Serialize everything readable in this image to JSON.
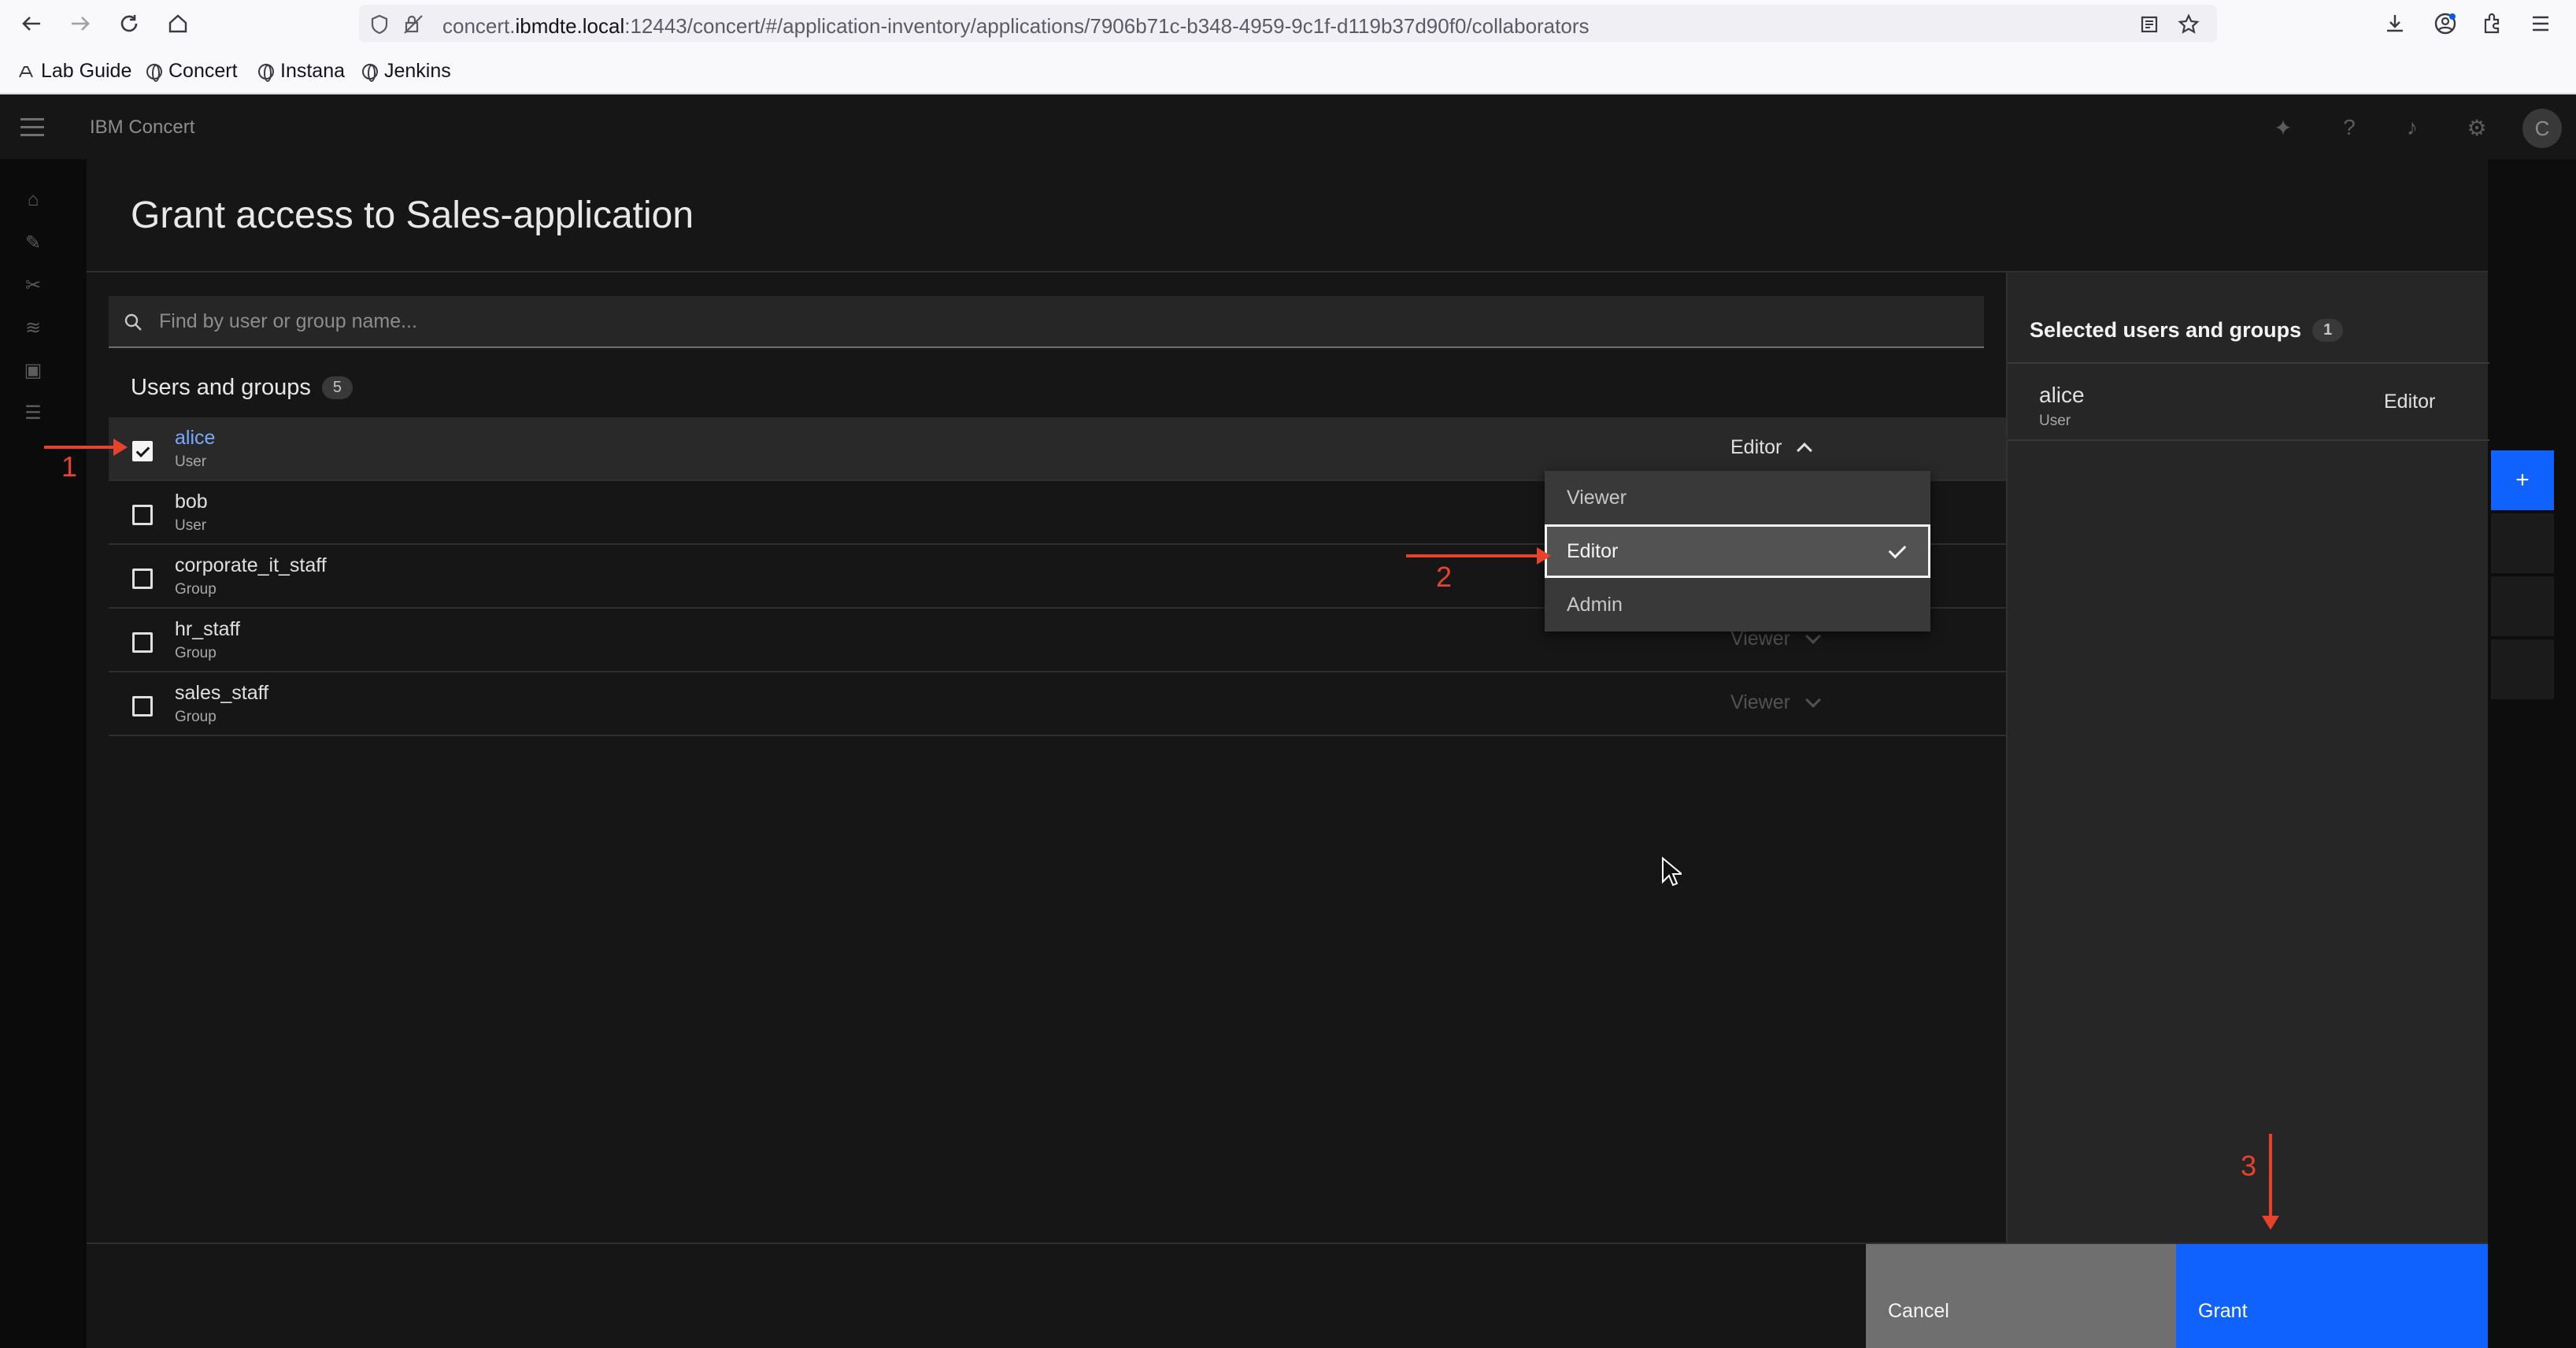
{
  "browser": {
    "url_prefix": "concert.",
    "url_host": "ibmdte.local",
    "url_rest": ":12443/concert/#/application-inventory/applications/7906b71c-b348-4959-9c1f-d119b37d90f0/collaborators",
    "bookmarks": [
      "Lab Guide",
      "Concert",
      "Instana",
      "Jenkins"
    ]
  },
  "app": {
    "title": "IBM Concert",
    "avatar_initial": "C"
  },
  "modal": {
    "title": "Grant access to Sales-application",
    "search_placeholder": "Find by user or group name...",
    "users_label": "Users and groups",
    "users_count": "5",
    "rows": [
      {
        "name": "alice",
        "type": "User",
        "role": "Editor",
        "checked": true
      },
      {
        "name": "bob",
        "type": "User",
        "role": "",
        "checked": false
      },
      {
        "name": "corporate_it_staff",
        "type": "Group",
        "role": "",
        "checked": false
      },
      {
        "name": "hr_staff",
        "type": "Group",
        "role": "Viewer",
        "checked": false
      },
      {
        "name": "sales_staff",
        "type": "Group",
        "role": "Viewer",
        "checked": false
      }
    ],
    "role_menu": [
      "Viewer",
      "Editor",
      "Admin"
    ],
    "selected_label": "Selected users and groups",
    "selected_count": "1",
    "selected": [
      {
        "name": "alice",
        "type": "User",
        "role": "Editor"
      }
    ],
    "cancel_label": "Cancel",
    "grant_label": "Grant"
  },
  "annotations": {
    "step1": "1",
    "step2": "2",
    "step3": "3",
    "color": "#e8412c"
  },
  "colors": {
    "accent": "#0f62fe",
    "link": "#78a9ff"
  }
}
